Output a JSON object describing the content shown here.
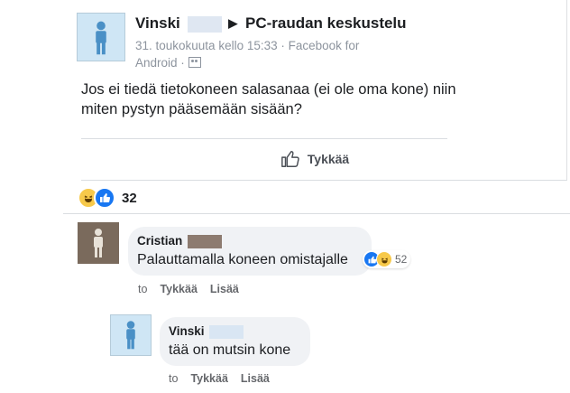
{
  "post": {
    "author": "Vinski",
    "group": "PC-raudan keskustelu",
    "meta_line1": "31. toukokuuta kello 15:33 · Facebook for",
    "meta_line2": "Android ·",
    "text": "Jos ei tiedä tietokoneen salasanaa (ei ole oma kone) niin miten pystyn pääsemään sisään?",
    "like_label": "Tykkää",
    "reaction_count": "32",
    "reaction_icons": [
      "haha-emoji",
      "like-emoji"
    ]
  },
  "comments": [
    {
      "author": "Cristian",
      "text": "Palauttamalla koneen omistajalle",
      "reaction_count": "52",
      "actions": {
        "prefix": "to",
        "like": "Tykkää",
        "more": "Lisää"
      }
    },
    {
      "author": "Vinski",
      "text": "tää on mutsin kone",
      "actions": {
        "prefix": "to",
        "like": "Tykkää",
        "more": "Lisää"
      }
    }
  ],
  "colors": {
    "link_blue": "#1877f2",
    "text": "#1c1e21",
    "muted": "#65676b",
    "bubble": "#f0f2f5"
  }
}
